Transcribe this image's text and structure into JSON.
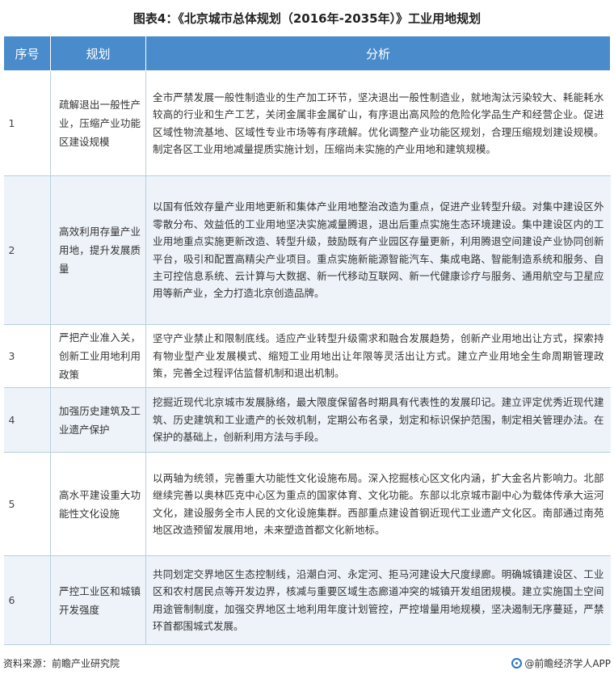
{
  "title": "图表4：《北京城市总体规划（2016年-2035年）》工业用地规划",
  "table": {
    "headers": [
      "序号",
      "规划",
      "分析"
    ],
    "rows": [
      {
        "no": "1",
        "plan": "疏解退出一般性产业，压缩产业功能区建设规模",
        "analysis": "全市严禁发展一般性制造业的生产加工环节，坚决退出一般性制造业，就地淘汰污染较大、耗能耗水较高的行业和生产工艺，关闭金属非金属矿山，有序退出高风险的危险化学品生产和经营企业。促进区域性物流基地、区域性专业市场等有序疏解。优化调整产业功能区规划，合理压缩规划建设规模。制定各区工业用地减量提质实施计划，压缩尚未实施的产业用地和建筑规模。"
      },
      {
        "no": "2",
        "plan": "高效利用存量产业用地，提升发展质量",
        "analysis": "以国有低效存量产业用地更新和集体产业用地整治改造为重点，促进产业转型升级。对集中建设区外零散分布、效益低的工业用地坚决实施减量腾退，退出后重点实施生态环境建设。集中建设区内的工业用地重点实施更新改造、转型升级，鼓励既有产业园区存量更新，利用腾退空间建设产业协同创新平台，吸引和配置高精尖产业项目。重点实施新能源智能汽车、集成电路、智能制造系统和服务、自主可控信息系统、云计算与大数据、新一代移动互联网、新一代健康诊疗与服务、通用航空与卫星应用等新产业，全力打造北京创造品牌。"
      },
      {
        "no": "3",
        "plan": "严把产业准入关，创新工业用地利用政策",
        "analysis": "坚守产业禁止和限制底线。适应产业转型升级需求和融合发展趋势，创新产业用地出让方式，探索持有物业型产业发展模式、缩短工业用地出让年限等灵活出让方式。建立产业用地全生命周期管理政策，完善全过程评估监督机制和退出机制。"
      },
      {
        "no": "4",
        "plan": "加强历史建筑及工业遗产保护",
        "analysis": "挖掘近现代北京城市发展脉络，最大限度保留各时期具有代表性的发展印记。建立评定优秀近现代建筑、历史建筑和工业遗产的长效机制，定期公布名录，划定和标识保护范围，制定相关管理办法。在保护的基础上，创新利用方法与手段。"
      },
      {
        "no": "5",
        "plan": "高水平建设重大功能性文化设施",
        "analysis": "以两轴为统领，完善重大功能性文化设施布局。深入挖掘核心区文化内涵，扩大金名片影响力。北部继续完善以奥林匹克中心区为重点的国家体育、文化功能。东部以北京城市副中心为载体传承大运河文化，建设服务全市人民的文化设施集群。西部重点建设首钢近现代工业遗产文化区。南部通过南苑地区改造预留发展用地，未来塑造首都文化新地标。"
      },
      {
        "no": "6",
        "plan": "严控工业区和城镇开发强度",
        "analysis": "共同划定交界地区生态控制线，沿潮白河、永定河、拒马河建设大尺度绿廊。明确城镇建设区、工业区和农村居民点等开发边界，核减与重要区域生态廊道冲突的城镇开发组团规模。建立实施国土空间用途管制制度，加强交界地区土地利用年度计划管控，严控增量用地规模，坚决遏制无序蔓延，严禁环首都围城式发展。"
      }
    ]
  },
  "footer": {
    "source": "资料来源：前瞻产业研究院",
    "brand": "@前瞻经济学人APP"
  },
  "watermark": "前瞻产业研究院",
  "colors": {
    "header_bg": "#4a8bcb",
    "row_alt_bg": "#edf3f9",
    "border": "#b8cde0"
  }
}
